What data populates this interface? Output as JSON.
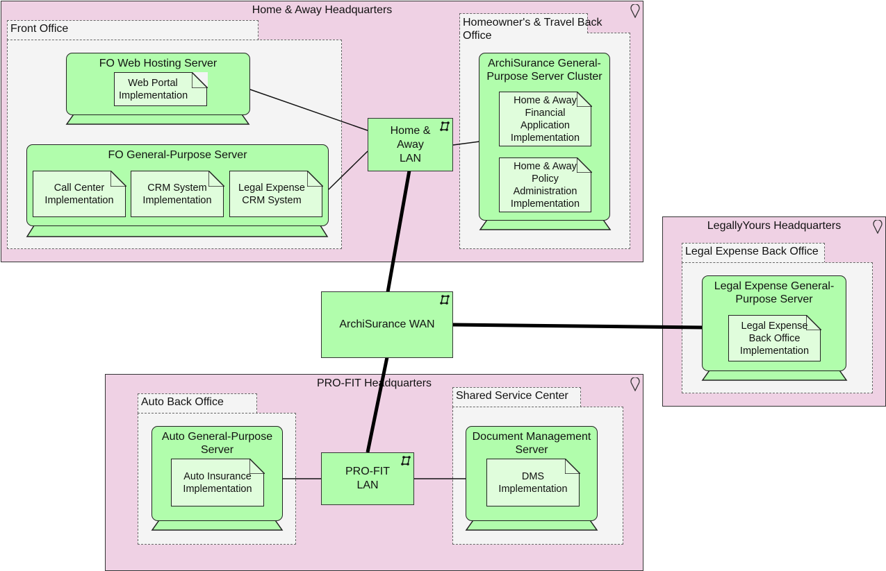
{
  "locations": {
    "home_away": {
      "title": "Home & Away Headquarters"
    },
    "legally_yours": {
      "title": "LegallyYours Headquarters"
    },
    "pro_fit": {
      "title": "PRO-FIT Headquarters"
    }
  },
  "groups": {
    "front_office": "Front Office",
    "homeowners_back_office": "Homeowner's & Travel Back Office",
    "legal_expense_back_office": "Legal Expense Back Office",
    "auto_back_office": "Auto Back Office",
    "shared_service_center": "Shared Service Center"
  },
  "nodes": {
    "fo_web_hosting": {
      "title": "FO Web Hosting Server",
      "artifacts": [
        "Web Portal Implementation"
      ]
    },
    "fo_general_purpose": {
      "title": "FO General-Purpose Server",
      "artifacts": [
        "Call Center Implementation",
        "CRM System Implementation",
        "Legal Expense CRM System"
      ]
    },
    "archisurance_cluster": {
      "title": "ArchiSurance General-Purpose Server Cluster",
      "artifacts": [
        "Home & Away Financial Application Implementation",
        "Home & Away Policy Administration Implementation"
      ]
    },
    "legal_expense_server": {
      "title": "Legal Expense General-Purpose Server",
      "artifacts": [
        "Legal Expense Back Office Implementation"
      ]
    },
    "auto_server": {
      "title": "Auto General-Purpose Server",
      "artifacts": [
        "Auto Insurance Implementation"
      ]
    },
    "dms_server": {
      "title": "Document Management Server",
      "artifacts": [
        "DMS Implementation"
      ]
    }
  },
  "networks": {
    "home_away_lan": "Home & Away LAN",
    "archisurance_wan": "ArchiSurance WAN",
    "pro_fit_lan": "PRO-FIT LAN"
  },
  "colors": {
    "location_fill": "#efd1e4",
    "group_fill": "#f4f4f4",
    "node_fill": "#b1fdac",
    "artifact_fill": "#e0fddc"
  }
}
